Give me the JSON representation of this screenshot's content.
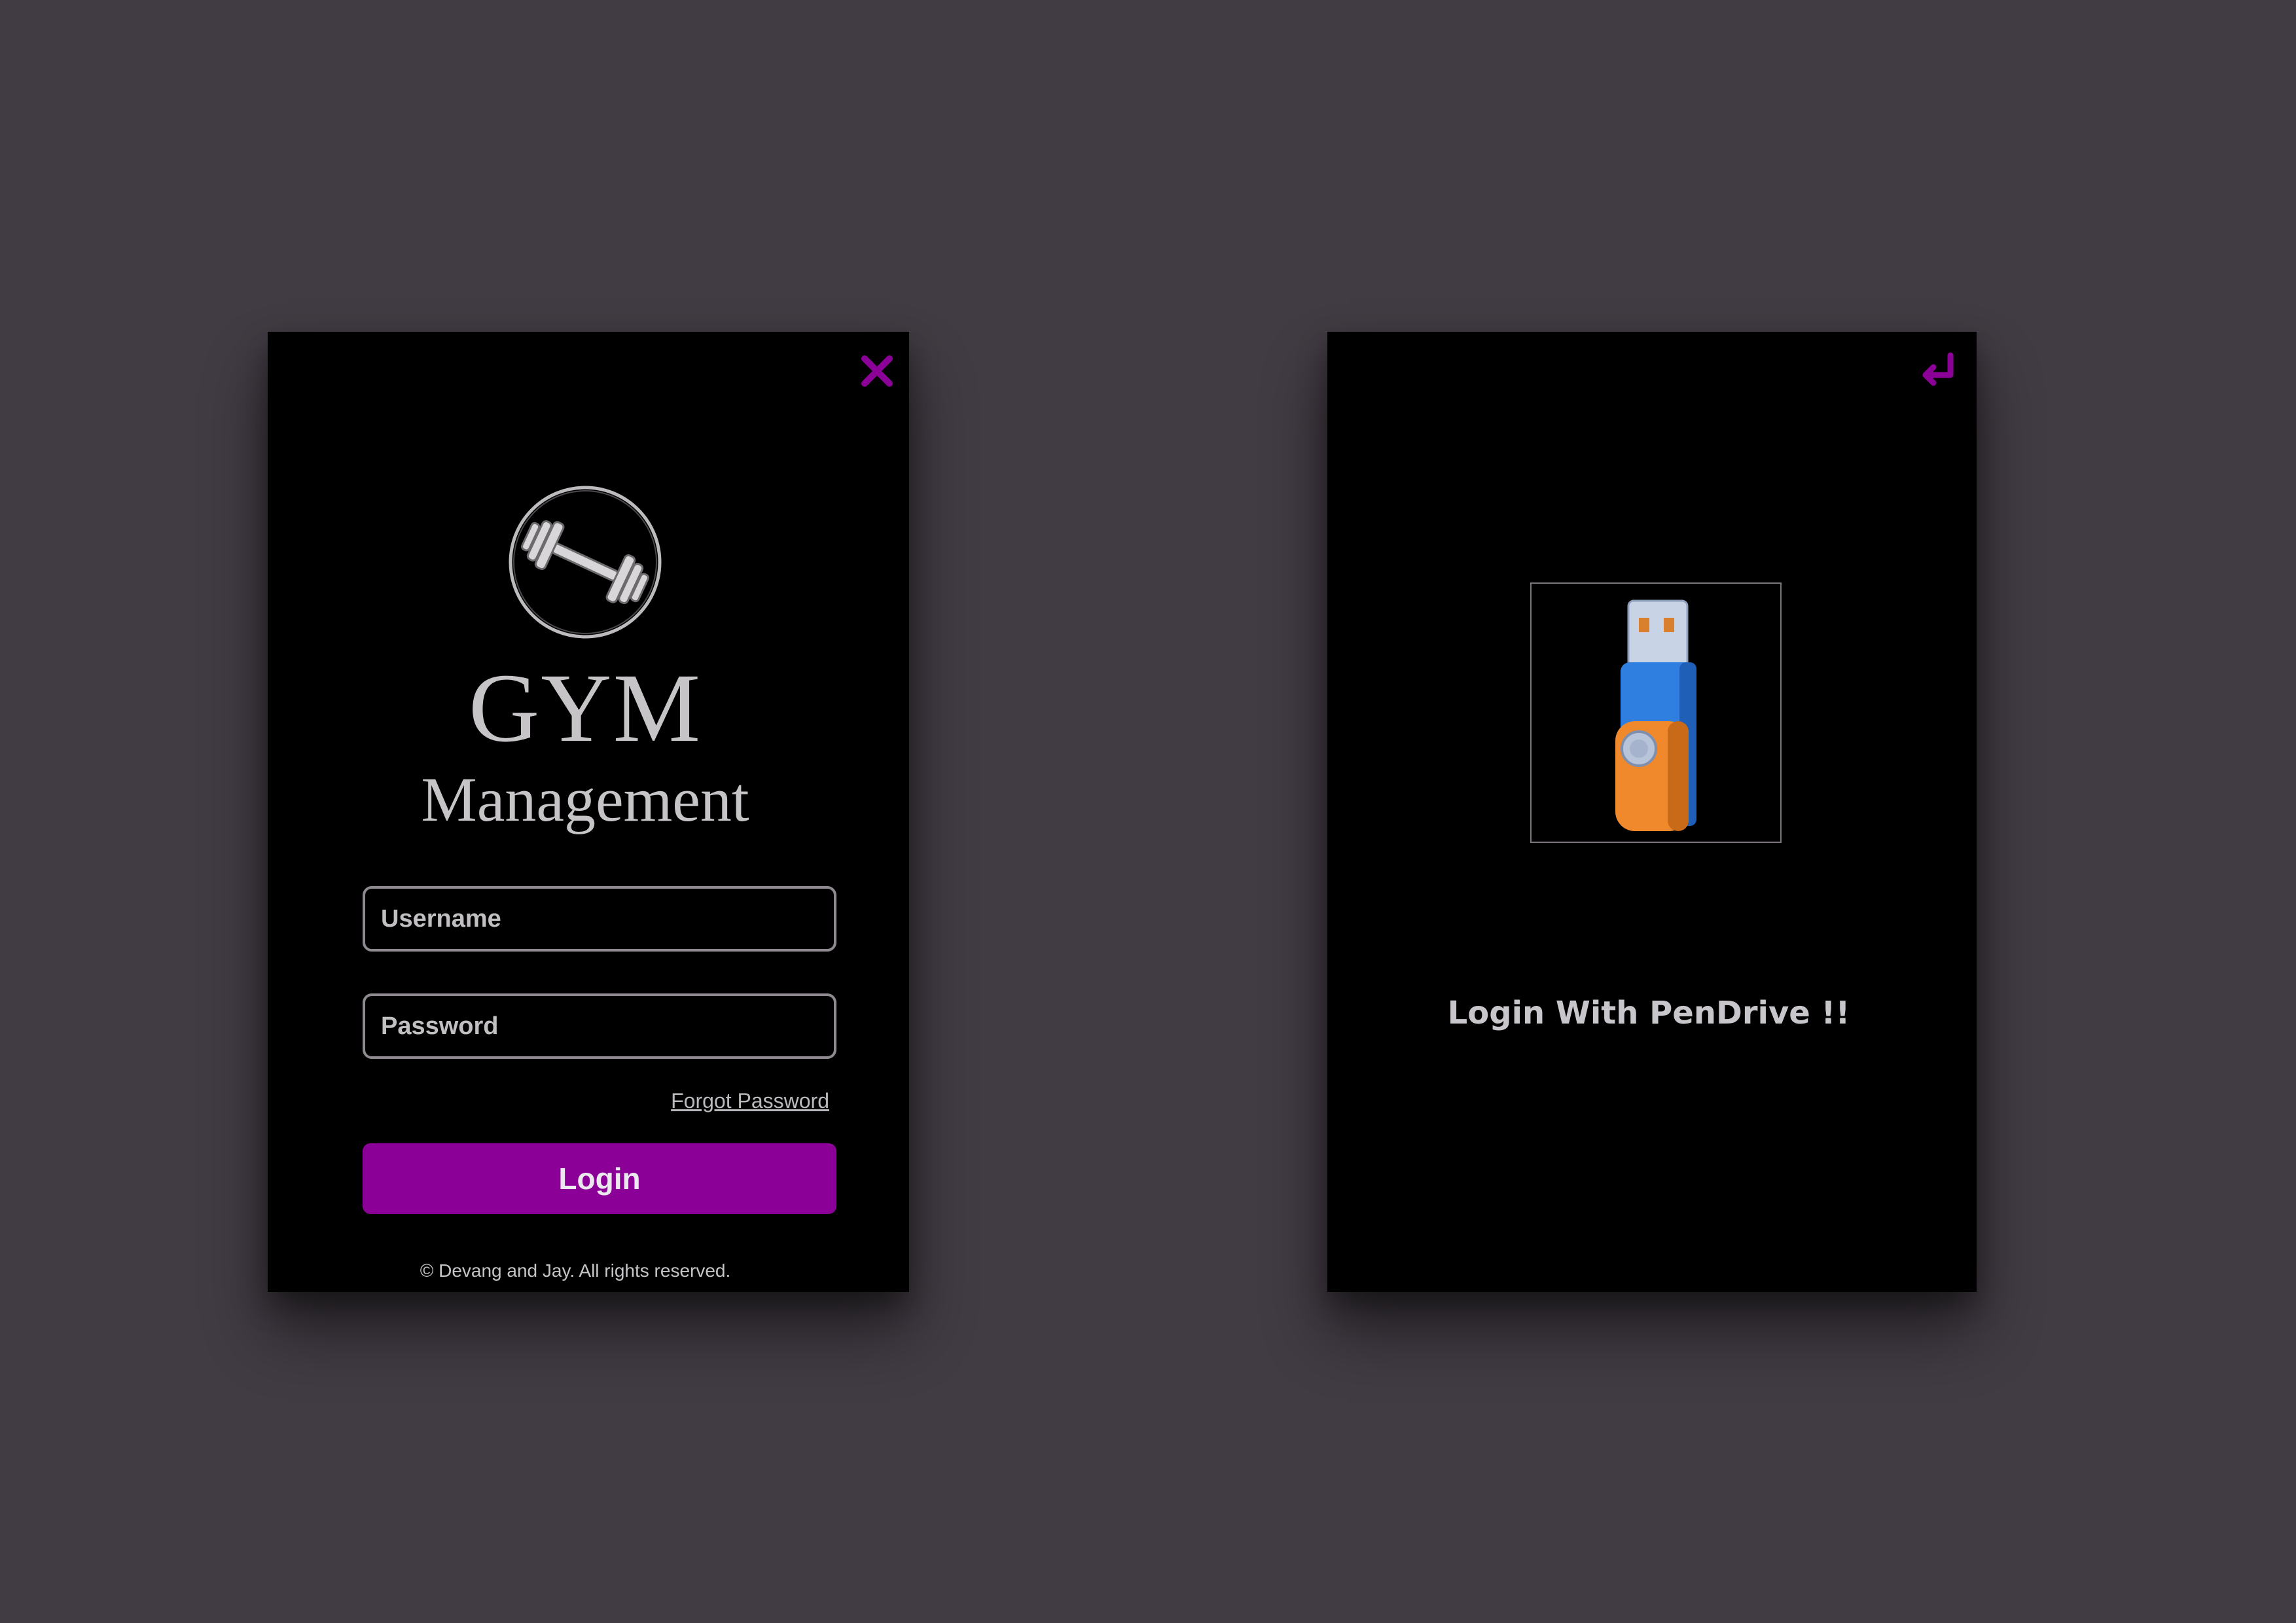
{
  "login": {
    "title_line1": "GYM",
    "title_line2": "Management",
    "username_placeholder": "Username",
    "password_placeholder": "Password",
    "forgot_password": "Forgot Password",
    "login_button": "Login",
    "copyright": "© Devang and Jay. All rights reserved.",
    "logo_icon": "dumbbell-icon",
    "close_icon": "close-icon"
  },
  "pendrive": {
    "label": "Login With PenDrive !!",
    "image_icon": "usb-pendrive-icon",
    "back_icon": "return-arrow-icon"
  },
  "colors": {
    "background": "#413b43",
    "panel": "#000000",
    "accent": "#8b0096",
    "text": "#c6c4c7"
  }
}
